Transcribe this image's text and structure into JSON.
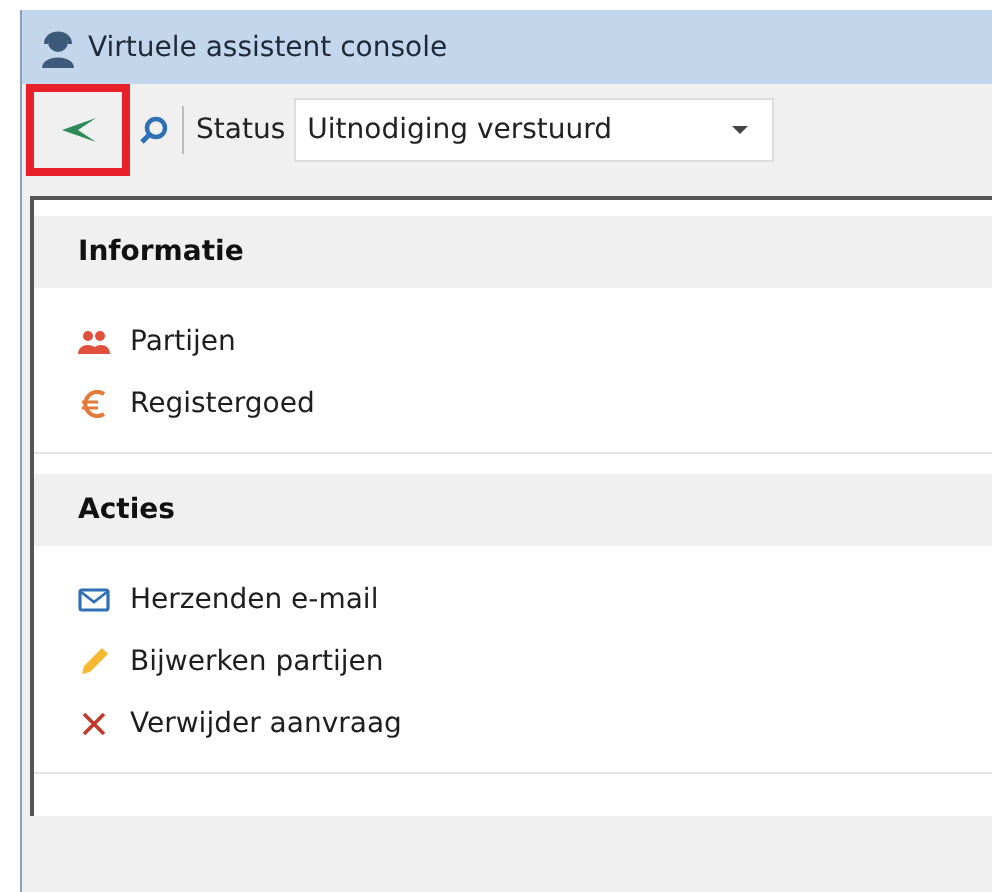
{
  "window": {
    "title": "Virtuele assistent console"
  },
  "toolbar": {
    "back_button": {
      "highlighted": true
    },
    "status_label": "Status",
    "status_value": "Uitnodiging verstuurd"
  },
  "sections": [
    {
      "title": "Informatie",
      "items": [
        {
          "kind": "people",
          "label": "Partijen"
        },
        {
          "kind": "euro",
          "label": "Registergoed"
        }
      ]
    },
    {
      "title": "Acties",
      "items": [
        {
          "kind": "mail",
          "label": "Herzenden e-mail"
        },
        {
          "kind": "pencil",
          "label": "Bijwerken partijen"
        },
        {
          "kind": "delete",
          "label": "Verwijder aanvraag"
        }
      ]
    }
  ]
}
